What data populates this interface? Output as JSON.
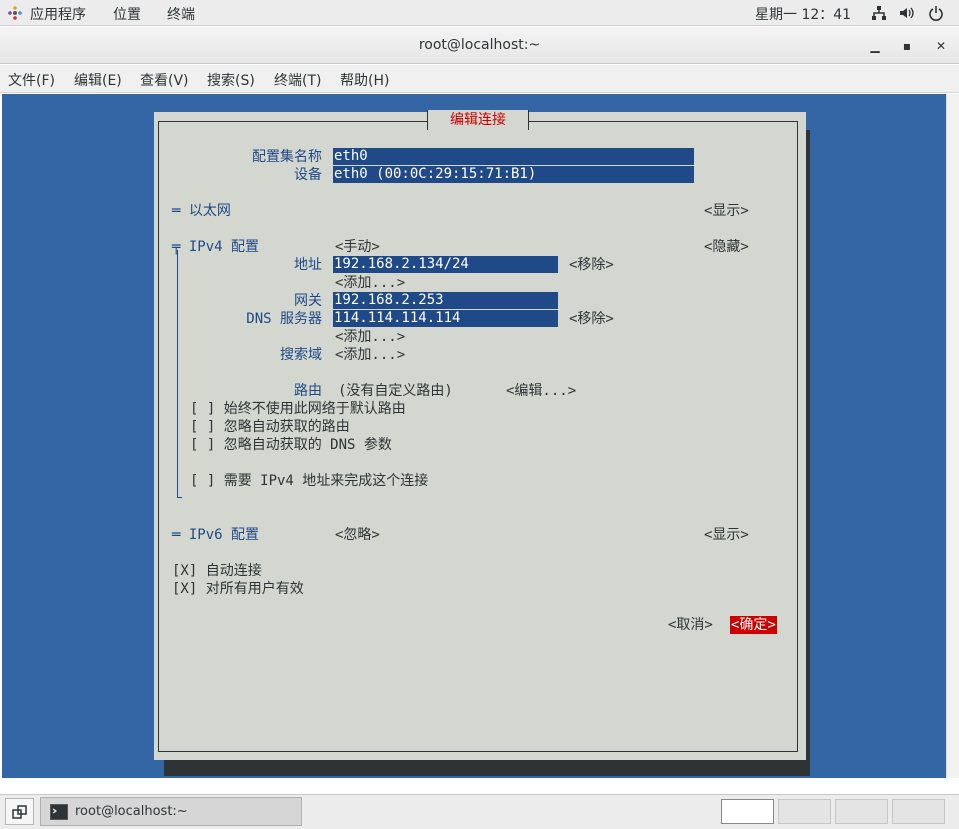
{
  "topbar": {
    "apps_label": "应用程序",
    "places_label": "位置",
    "terminal_label": "终端",
    "clock": "星期一 12：41"
  },
  "window": {
    "title": "root@localhost:~"
  },
  "menubar": {
    "items": [
      "文件(F)",
      "编辑(E)",
      "查看(V)",
      "搜索(S)",
      "终端(T)",
      "帮助(H)"
    ]
  },
  "dialog": {
    "title": "编辑连接",
    "profile_name_label": "配置集名称",
    "profile_name_value": "eth0",
    "device_label": "设备",
    "device_value": "eth0 (00:0C:29:15:71:B1)",
    "ethernet_label": "═ 以太网",
    "ethernet_toggle": "<显示>",
    "ipv4_label": "╤ IPv4 配置",
    "ipv4_mode": "<手动>",
    "ipv4_toggle": "<隐藏>",
    "addresses_label": "地址",
    "address_value": "192.168.2.134/24",
    "remove1": "<移除>",
    "add1": "<添加...>",
    "gateway_label": "网关",
    "gateway_value": "192.168.2.253",
    "dns_label": "DNS 服务器",
    "dns_value": "114.114.114.114",
    "remove2": "<移除>",
    "add2": "<添加...>",
    "search_domains_label": "搜索域",
    "add3": "<添加...>",
    "routing_label": "路由",
    "routing_value": "(没有自定义路由)",
    "routing_edit": "<编辑...>",
    "never_default": "[ ] 始终不使用此网络于默认路由",
    "ignore_routes": "[ ] 忽略自动获取的路由",
    "ignore_dns": "[ ] 忽略自动获取的 DNS 参数",
    "require_ipv4": "[ ] 需要 IPv4 地址来完成这个连接",
    "ipv6_label": "═ IPv6 配置",
    "ipv6_mode": "<忽略>",
    "ipv6_toggle": "<显示>",
    "auto_connect": "[X] 自动连接",
    "all_users": "[X] 对所有用户有效",
    "cancel": "<取消>",
    "ok": "<确定>"
  },
  "taskbar": {
    "task_label": "root@localhost:~"
  }
}
